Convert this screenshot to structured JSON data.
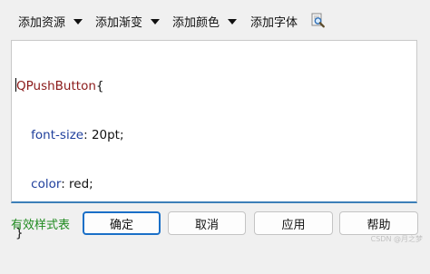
{
  "toolbar": {
    "items": [
      {
        "label": "添加资源"
      },
      {
        "label": "添加渐变"
      },
      {
        "label": "添加颜色"
      },
      {
        "label": "添加字体"
      }
    ]
  },
  "editor": {
    "lines": [
      {
        "selector": "QPushButton",
        "open": "{"
      },
      {
        "property": "font-size",
        "value": "20pt;"
      },
      {
        "property": "color",
        "value": "red;"
      },
      {
        "close": "}"
      }
    ]
  },
  "status": {
    "text": "有效样式表"
  },
  "buttons": {
    "ok": "确定",
    "cancel": "取消",
    "apply": "应用",
    "help": "帮助"
  },
  "watermark": "CSDN @月之梦"
}
